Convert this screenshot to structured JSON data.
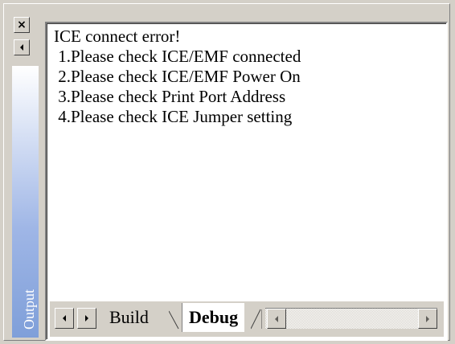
{
  "window": {
    "panel_label": "Output",
    "close_glyph": "×",
    "colors": {
      "background": "#d4d0c8",
      "pane": "#ffffff",
      "dock_strip": "#7f9fd9"
    }
  },
  "messages": [
    "ICE connect error!",
    " 1.Please check ICE/EMF connected",
    " 2.Please check ICE/EMF Power On",
    " 3.Please check Print Port Address",
    " 4.Please check ICE Jumper setting"
  ],
  "tabs": [
    {
      "label": "Build",
      "active": false
    },
    {
      "label": "Debug",
      "active": true
    }
  ],
  "icons": {
    "close": "close-icon",
    "dock_left": "arrow-left-icon",
    "tab_prev": "tab-scroll-left-icon",
    "tab_next": "tab-scroll-right-icon",
    "hscroll_left": "scroll-left-icon",
    "hscroll_right": "scroll-right-icon"
  }
}
